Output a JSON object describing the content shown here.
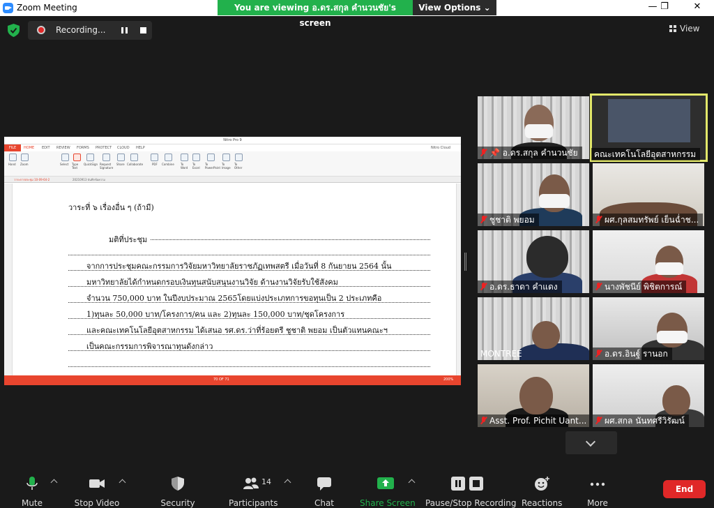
{
  "window": {
    "title": "Zoom Meeting"
  },
  "banner": {
    "viewing": "You are viewing อ.ดร.สกุล คำนวนชัย's screen",
    "view_options": "View Options"
  },
  "top": {
    "recording": "Recording...",
    "view": "View"
  },
  "shared": {
    "app_title": "Nitro Pro 9",
    "file_tab": "FILE",
    "tabs": [
      "HOME",
      "EDIT",
      "REVIEW",
      "FORMS",
      "PROTECT",
      "CLOUD",
      "HELP"
    ],
    "account": "Nitro Cloud",
    "ribbon": [
      "Hand",
      "Zoom",
      "Select",
      "Type Text",
      "QuickSign",
      "Request Signature",
      "Share",
      "Collaborate",
      "PDF",
      "Combine",
      "To Word",
      "To Excel",
      "To PowerPoint",
      "To Image",
      "To Other"
    ],
    "doctabs": [
      "วาระการประชุม 10-09-64-2",
      "20210913 บันทึกข้อความ"
    ],
    "lines": [
      "วาระที่  ๖   เรื่องอื่น ๆ (ถ้ามี)",
      "มติที่ประชุม",
      "จากการประชุมคณะกรรมการวิจัยมหาวิทยาลัยราชภัฏเทพสตรี เมื่อวันที่ 8 กันยายน 2564 นั้น",
      "มหาวิทยาลัยได้กำหนดกรอบเงินทุนสนับสนุนงานวิจัย ด้านงานวิจัยรับใช้สังคม",
      "จำนวน 750,000 บาท ในปีงบประมาณ 2565โดยแบ่งประเภทการขอทุนเป็น 2 ประเภทคือ",
      "1)ทุนละ 50,000 บาท/โครงการ/คน และ 2)ทุนละ 150,000 บาท/ชุดโครงการ",
      "และคณะเทคโนโลยีอุตสาหกรรม ได้เสนอ รศ.ดร.ว่าที่ร้อยตรี ชูชาติ พยอม เป็นตัวแทนคณะฯ",
      "เป็นคณะกรรมการพิจารณาทุนดังกล่าว"
    ],
    "page_indicator": "70 OF 71",
    "zoom": "200%"
  },
  "participants": [
    {
      "name": "อ.ดร.สกุล  คำนวนชัย"
    },
    {
      "name": "คณะเทคโนโลยีอุตสาหกรรม"
    },
    {
      "name": "ชูชาติ  พยอม"
    },
    {
      "name": "ผศ.กุลสมทรัพย์  เย็นฉ่ำช..."
    },
    {
      "name": "อ.ดร.ธาดา  คำแดง"
    },
    {
      "name": "นางพัชนีย์  พิชิตการณ์"
    },
    {
      "name": "MONTREE"
    },
    {
      "name": "อ.ดร.อินฐ์  รานอก"
    },
    {
      "name": "Asst. Prof. Pichit Uant..."
    },
    {
      "name": "ผศ.สกล  นันทศรีวิรัฒน์"
    }
  ],
  "toolbar": {
    "mute": "Mute",
    "stop_video": "Stop Video",
    "security": "Security",
    "participants": "Participants",
    "participant_count": "14",
    "chat": "Chat",
    "share_screen": "Share Screen",
    "pause_recording": "Pause/Stop Recording",
    "reactions": "Reactions",
    "more": "More",
    "end": "End"
  }
}
